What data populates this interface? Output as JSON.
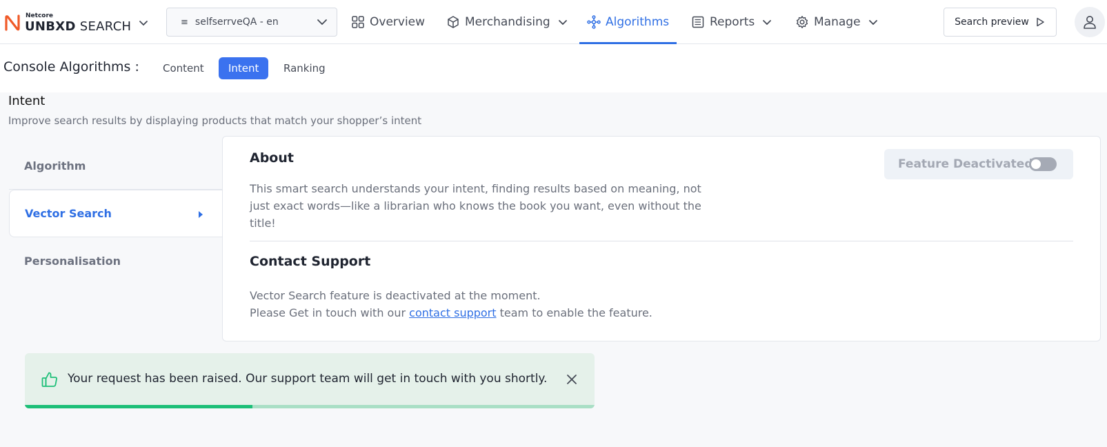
{
  "header": {
    "logo": {
      "small": "Netcore",
      "brand_bold": "UNBXD",
      "brand_light": "SEARCH"
    },
    "site_selector": {
      "value": "selfserrveQA - en"
    },
    "nav": [
      {
        "label": "Overview",
        "icon": "grid-icon",
        "dropdown": false,
        "active": false
      },
      {
        "label": "Merchandising",
        "icon": "cube-icon",
        "dropdown": true,
        "active": false
      },
      {
        "label": "Algorithms",
        "icon": "network-icon",
        "dropdown": false,
        "active": true
      },
      {
        "label": "Reports",
        "icon": "report-icon",
        "dropdown": true,
        "active": false
      },
      {
        "label": "Manage",
        "icon": "gear-icon",
        "dropdown": true,
        "active": false
      }
    ],
    "search_preview_label": "Search preview"
  },
  "console": {
    "title": "Console Algorithms :",
    "tabs": [
      {
        "label": "Content",
        "active": false
      },
      {
        "label": "Intent",
        "active": true
      },
      {
        "label": "Ranking",
        "active": false
      }
    ]
  },
  "section": {
    "title": "Intent",
    "description": "Improve search results by displaying products that match your shopper’s intent"
  },
  "left_nav": {
    "items": [
      {
        "label": "Algorithm"
      },
      {
        "label": "Vector Search",
        "active": true
      },
      {
        "label": "Personalisation"
      }
    ]
  },
  "main": {
    "about_title": "About",
    "about_text": "This smart search understands your intent, finding results based on meaning, not just exact words—like a librarian who knows the book you want, even without the title!",
    "feature_status_label": "Feature Deactivated",
    "feature_enabled": false,
    "contact_title": "Contact Support",
    "contact_line1": "Vector Search feature is deactivated at the moment.",
    "contact_line2_prefix": "Please Get in touch with our",
    "contact_link": "contact support",
    "contact_line2_suffix": "team to enable the feature."
  },
  "toast": {
    "message": "Your request has been raised. Our support team will get in touch with you shortly.",
    "progress": 0.4
  },
  "colors": {
    "accent": "#2f6fe4",
    "tab_active_bg": "#3b72ef",
    "toast_bg": "#e5f1ea",
    "toast_progress": "#1dbf78",
    "logo_orange": "#f05a28"
  }
}
